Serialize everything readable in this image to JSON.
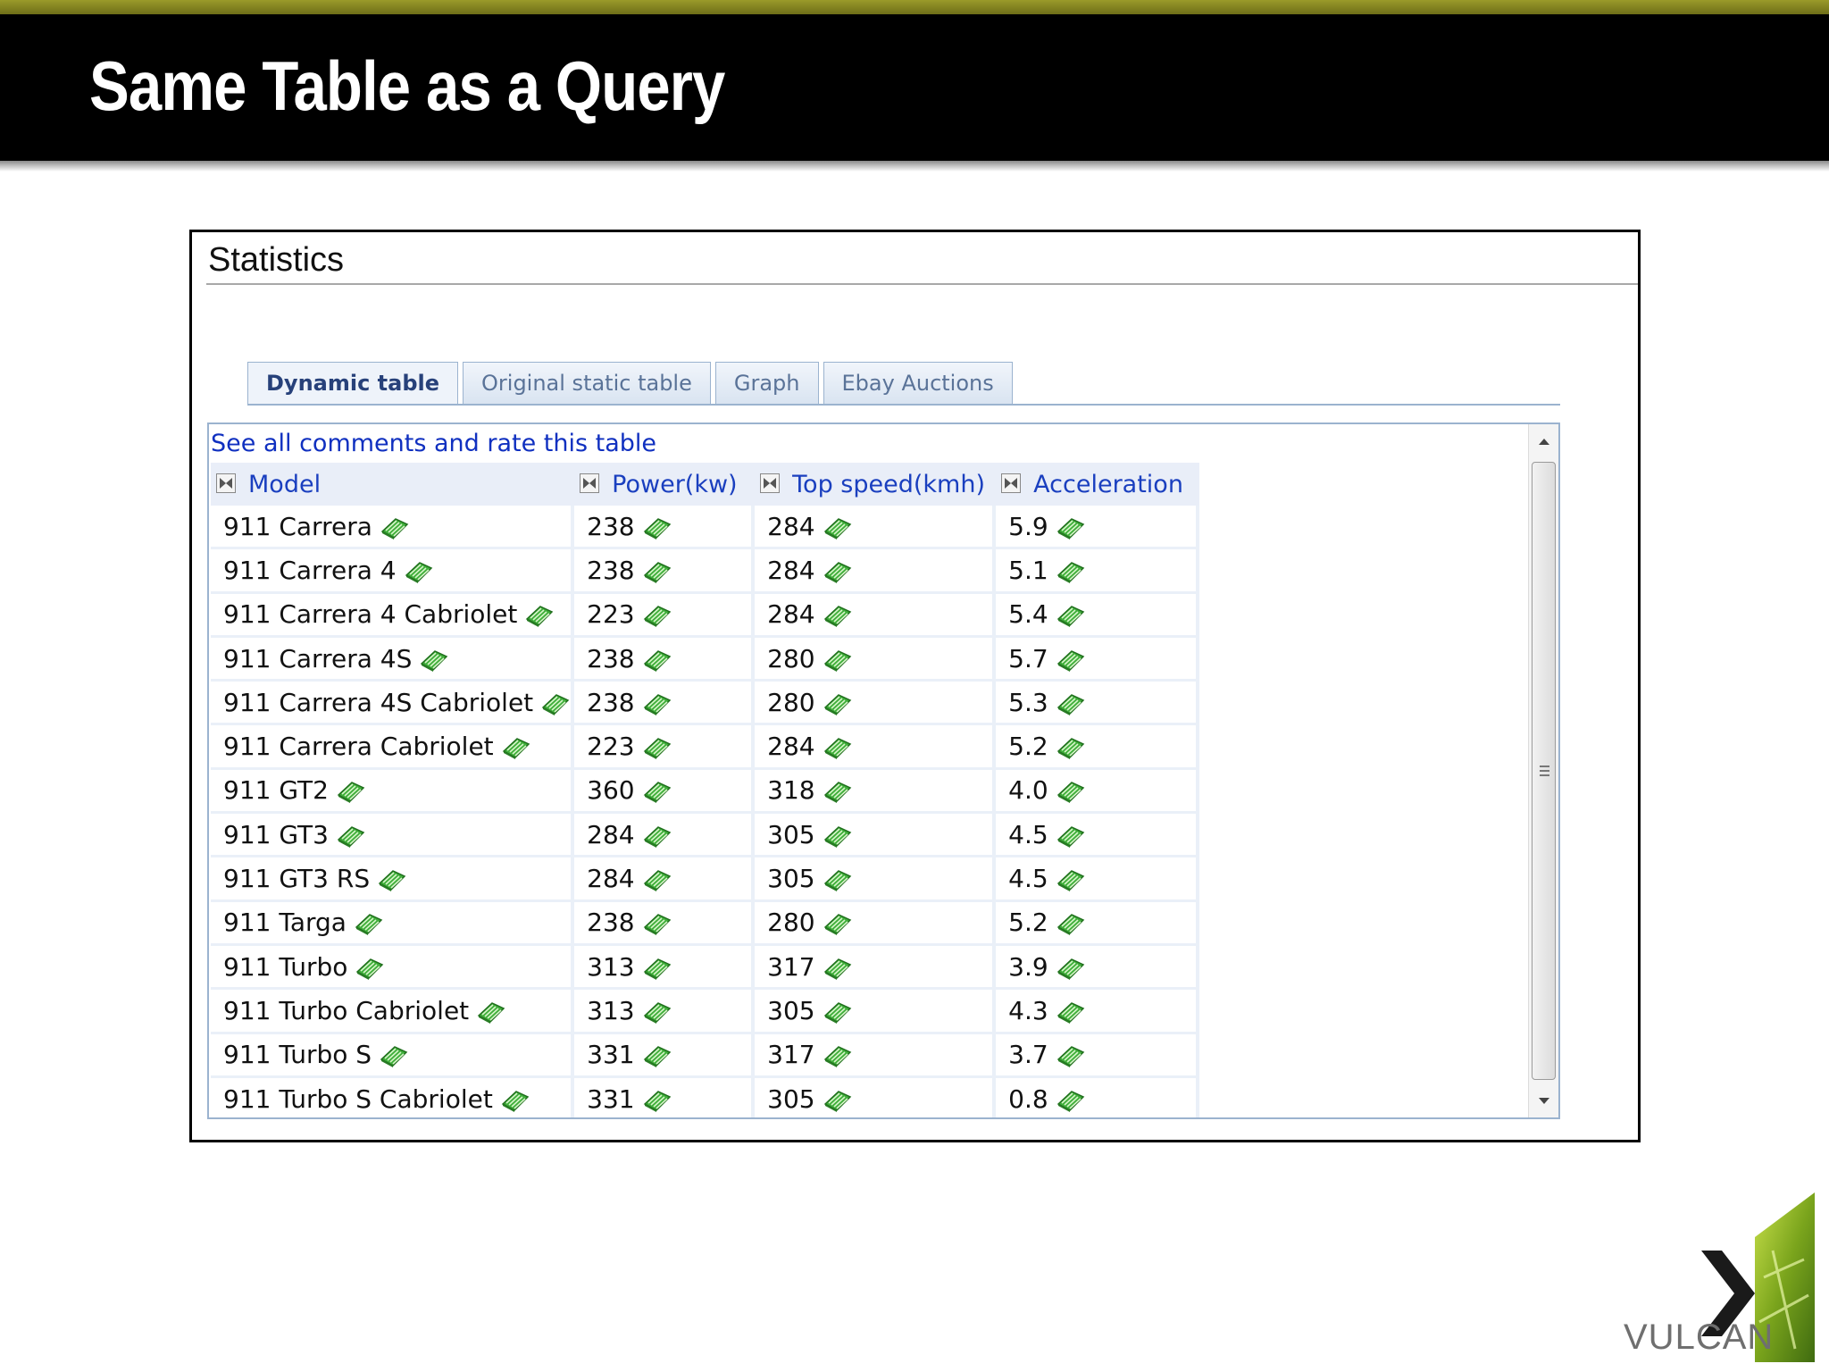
{
  "slide": {
    "title": "Same Table as a Query"
  },
  "panel": {
    "title": "Statistics",
    "tabs": [
      {
        "label": "Dynamic table",
        "active": true
      },
      {
        "label": "Original static table",
        "active": false
      },
      {
        "label": "Graph",
        "active": false
      },
      {
        "label": "Ebay Auctions",
        "active": false
      }
    ],
    "comments_link": "See all comments and rate this table"
  },
  "table": {
    "headers": [
      "Model",
      "Power(kw)",
      "Top speed(kmh)",
      "Acceleration"
    ],
    "rows": [
      [
        "911 Carrera",
        "238",
        "284",
        "5.9"
      ],
      [
        "911 Carrera 4",
        "238",
        "284",
        "5.1"
      ],
      [
        "911 Carrera 4 Cabriolet",
        "223",
        "284",
        "5.4"
      ],
      [
        "911 Carrera 4S",
        "238",
        "280",
        "5.7"
      ],
      [
        "911 Carrera 4S Cabriolet",
        "238",
        "280",
        "5.3"
      ],
      [
        "911 Carrera Cabriolet",
        "223",
        "284",
        "5.2"
      ],
      [
        "911 GT2",
        "360",
        "318",
        "4.0"
      ],
      [
        "911 GT3",
        "284",
        "305",
        "4.5"
      ],
      [
        "911 GT3 RS",
        "284",
        "305",
        "4.5"
      ],
      [
        "911 Targa",
        "238",
        "280",
        "5.2"
      ],
      [
        "911 Turbo",
        "313",
        "317",
        "3.9"
      ],
      [
        "911 Turbo Cabriolet",
        "313",
        "305",
        "4.3"
      ],
      [
        "911 Turbo S",
        "331",
        "317",
        "3.7"
      ],
      [
        "911 Turbo S Cabriolet",
        "331",
        "305",
        "0.8"
      ]
    ],
    "cell_icon": "comment-icon",
    "header_icon": "sort-icon"
  },
  "logo": {
    "text": "VULCAN"
  },
  "colors": {
    "header_bar": "#000000",
    "accent_stripe": "#8a8a22",
    "link": "#1030c0",
    "tab_border": "#9bb3cf",
    "comment_icon": "#3fae3a"
  }
}
